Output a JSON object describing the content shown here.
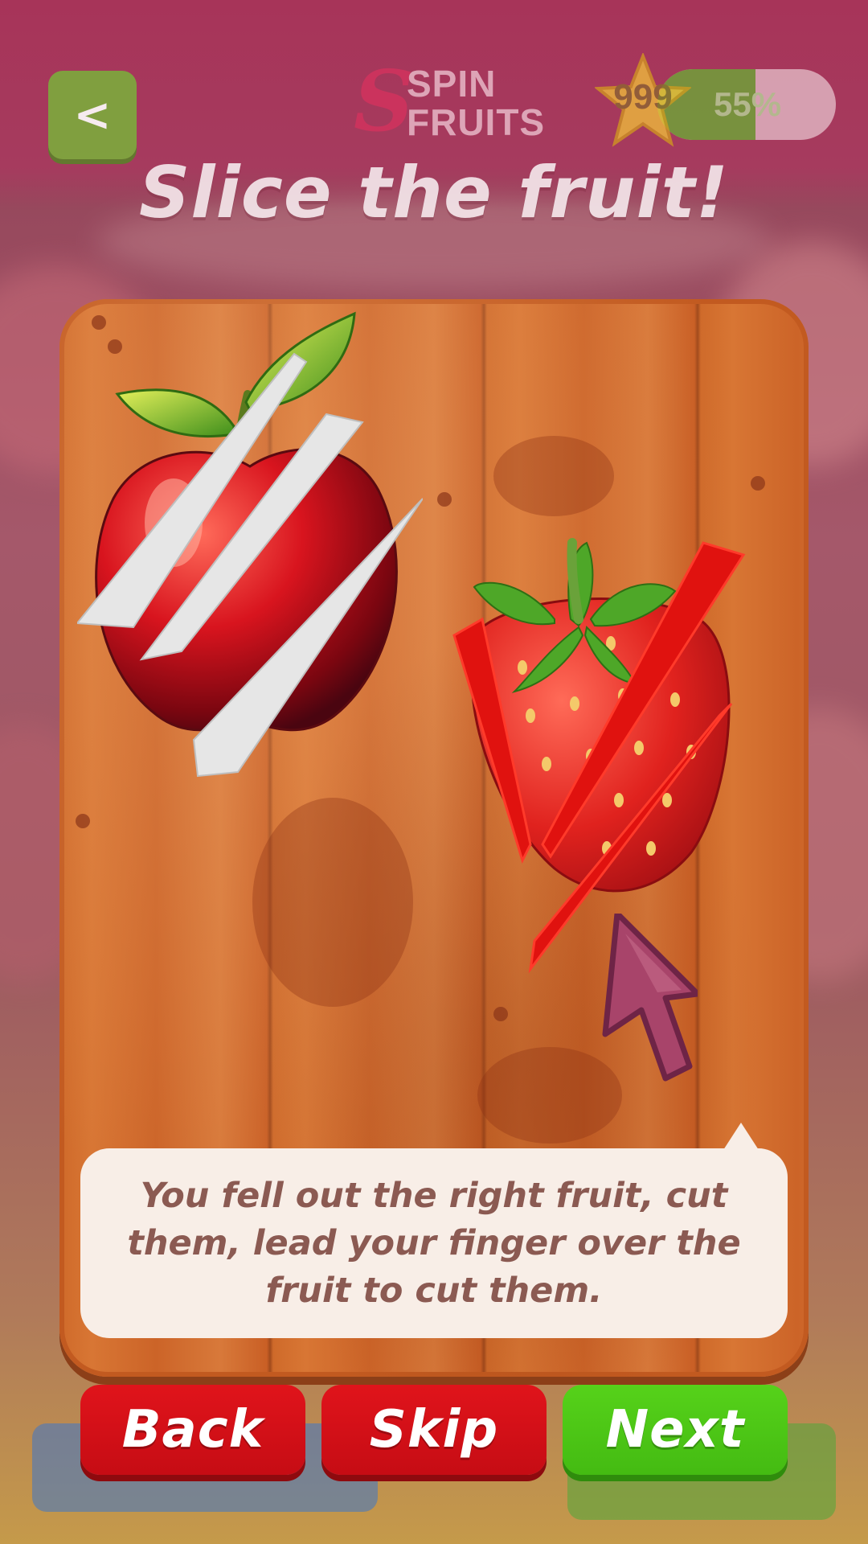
{
  "header": {
    "back_icon": "<",
    "logo_letter": "S",
    "logo_line1": "SPIN",
    "logo_line2": "FRUITS",
    "star_count": "999",
    "progress_text": "55%",
    "progress_value": 0.55
  },
  "title": "Slice the fruit!",
  "tutorial": {
    "message": "You fell out the right fruit, cut them, lead your finger over the fruit to cut them."
  },
  "buttons": {
    "back": "Back",
    "skip": "Skip",
    "next": "Next"
  },
  "colors": {
    "accent_red": "#e0141b",
    "accent_green": "#56d21a",
    "board_wood": "#cf6a2a",
    "bubble_text": "#8b5a52"
  }
}
